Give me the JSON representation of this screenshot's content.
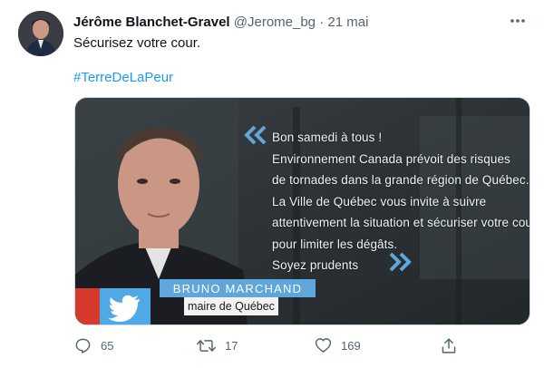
{
  "tweet": {
    "author_name": "Jérôme Blanchet-Gravel",
    "handle": "@Jerome_bg",
    "separator": "·",
    "date": "21 mai",
    "text": "Sécurisez votre cour.",
    "hashtag": "#TerreDeLaPeur"
  },
  "media": {
    "overlay_lines": [
      "Bon samedi à tous !",
      "Environnement Canada prévoit des risques",
      "de tornades dans la grande région de Québec.",
      "La Ville de Québec vous invite à suivre",
      "attentivement la situation et sécuriser votre cou",
      "pour limiter les dégâts.",
      "Soyez prudents"
    ],
    "person_name": "BRUNO MARCHAND",
    "person_title": "maire de Québec"
  },
  "actions": {
    "replies": "65",
    "retweets": "17",
    "likes": "169"
  },
  "icons": [
    "more-icon",
    "reply-icon",
    "retweet-icon",
    "like-icon",
    "share-icon",
    "twitter-bird-icon"
  ],
  "colors": {
    "accent": "#1d9bf0",
    "secondary_text": "#536471",
    "nameplate": "#5fa6da"
  }
}
